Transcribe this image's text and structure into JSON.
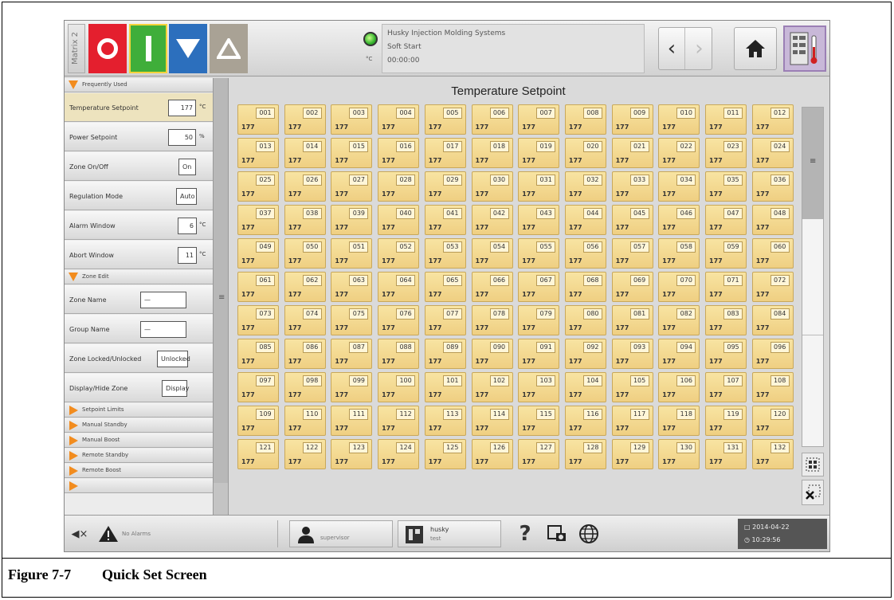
{
  "topbar": {
    "matrix_label": "Matrix 2",
    "led_unit": "°C",
    "status": {
      "line1": "Husky Injection Molding Systems",
      "line2": "Soft Start",
      "line3": "00:00:00"
    }
  },
  "left_panel": {
    "sections": {
      "frequently_used": "Frequently Used",
      "zone_edit": "Zone Edit"
    },
    "frequently_used": [
      {
        "label": "Temperature Setpoint",
        "value": "177",
        "unit": "°C"
      },
      {
        "label": "Power Setpoint",
        "value": "50",
        "unit": "%"
      },
      {
        "label": "Zone On/Off",
        "value": "On",
        "unit": ""
      },
      {
        "label": "Regulation Mode",
        "value": "Auto",
        "unit": ""
      },
      {
        "label": "Alarm Window",
        "value": "6",
        "unit": "°C"
      },
      {
        "label": "Abort Window",
        "value": "11",
        "unit": "°C"
      }
    ],
    "zone_edit": [
      {
        "label": "Zone Name",
        "value": "—"
      },
      {
        "label": "Group Name",
        "value": "—"
      },
      {
        "label": "Zone Locked/Unlocked",
        "value": "Unlocked"
      },
      {
        "label": "Display/Hide Zone",
        "value": "Display"
      }
    ],
    "collapsed_sections": [
      "Setpoint Limits",
      "Manual Standby",
      "Manual Boost",
      "Remote Standby",
      "Remote Boost"
    ]
  },
  "main": {
    "title": "Temperature Setpoint",
    "zone_value": "177",
    "zones": [
      "001",
      "002",
      "003",
      "004",
      "005",
      "006",
      "007",
      "008",
      "009",
      "010",
      "011",
      "012",
      "013",
      "014",
      "015",
      "016",
      "017",
      "018",
      "019",
      "020",
      "021",
      "022",
      "023",
      "024",
      "025",
      "026",
      "027",
      "028",
      "029",
      "030",
      "031",
      "032",
      "033",
      "034",
      "035",
      "036",
      "037",
      "038",
      "039",
      "040",
      "041",
      "042",
      "043",
      "044",
      "045",
      "046",
      "047",
      "048",
      "049",
      "050",
      "051",
      "052",
      "053",
      "054",
      "055",
      "056",
      "057",
      "058",
      "059",
      "060",
      "061",
      "062",
      "063",
      "064",
      "065",
      "066",
      "067",
      "068",
      "069",
      "070",
      "071",
      "072",
      "073",
      "074",
      "075",
      "076",
      "077",
      "078",
      "079",
      "080",
      "081",
      "082",
      "083",
      "084",
      "085",
      "086",
      "087",
      "088",
      "089",
      "090",
      "091",
      "092",
      "093",
      "094",
      "095",
      "096",
      "097",
      "098",
      "099",
      "100",
      "101",
      "102",
      "103",
      "104",
      "105",
      "106",
      "107",
      "108",
      "109",
      "110",
      "111",
      "112",
      "113",
      "114",
      "115",
      "116",
      "117",
      "118",
      "119",
      "120",
      "121",
      "122",
      "123",
      "124",
      "125",
      "126",
      "127",
      "128",
      "129",
      "130",
      "131",
      "132"
    ]
  },
  "bottombar": {
    "alarm_text": "No Alarms",
    "user": "supervisor",
    "husky_line1": "husky",
    "husky_line2": "test",
    "date": "2014-04-22",
    "time": "10:29:56"
  },
  "caption": {
    "number": "Figure 7-7",
    "text": "Quick Set Screen"
  },
  "colors": {
    "off_button": "#e41f2e",
    "on_button": "#3fae3a",
    "down_button": "#2c6fbd",
    "up_button": "#a9a295",
    "zone_tile": "#f3d98f",
    "section_arrow": "#f28c1e"
  }
}
